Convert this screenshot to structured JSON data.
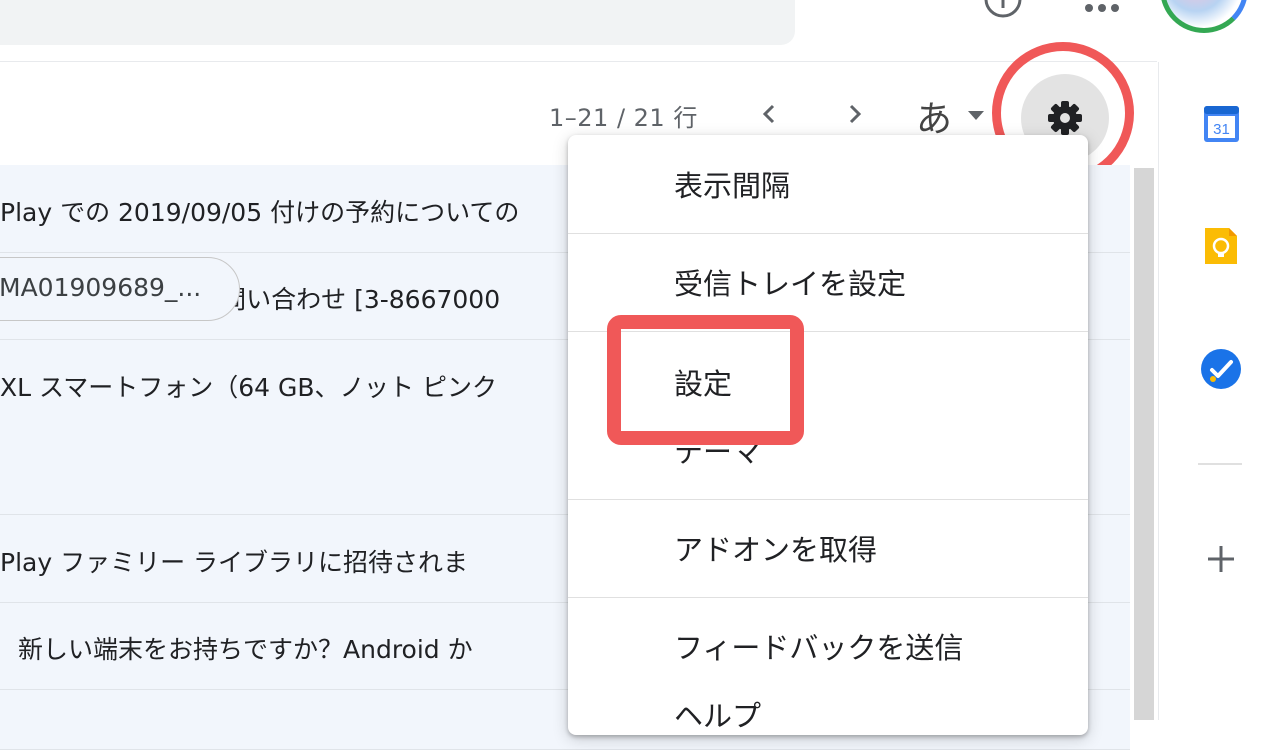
{
  "toolbar": {
    "pagination": "1–21 / 21 行",
    "input_tool_label": "あ"
  },
  "emails": [
    {
      "subject": "Play での 2019/09/05 付けの予約についての"
    },
    {
      "subject": "gle サポートへのお問い合わせ [3-8667000"
    },
    {
      "subject": "XL スマートフォン（64 GB、ノット ピンク"
    },
    {
      "subject": "Play ファミリー ライブラリに招待されま"
    },
    {
      "subject": "新しい端末をお持ちですか？Android か"
    }
  ],
  "attachment_chip": "MA01909689_...",
  "settings_menu": {
    "items": [
      "表示間隔",
      "受信トレイを設定",
      "設定",
      "テーマ",
      "アドオンを取得",
      "フィードバックを送信",
      "ヘルプ"
    ]
  },
  "side_panel": {
    "calendar_day": "31"
  },
  "colors": {
    "highlight": "#f05858",
    "calendar_blue": "#4285f4",
    "keep_yellow": "#fbbc04",
    "tasks_blue": "#1a73e8",
    "row_background": "#f2f6fc"
  },
  "icons": [
    "help-icon",
    "apps-icon",
    "gear-icon",
    "chevron-left-icon",
    "chevron-right-icon",
    "caret-down-icon",
    "calendar-icon",
    "keep-icon",
    "tasks-icon",
    "plus-icon"
  ]
}
